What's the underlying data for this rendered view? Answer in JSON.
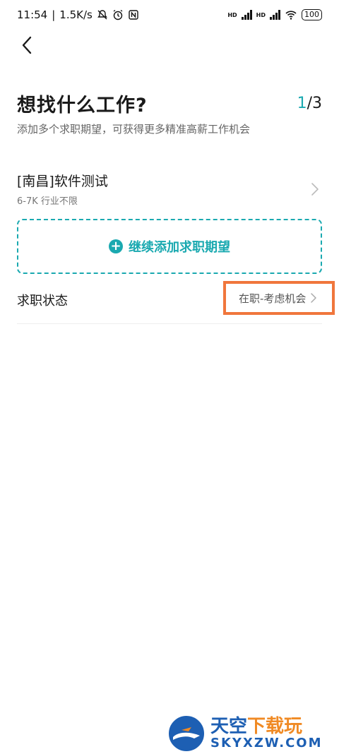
{
  "status_bar": {
    "time": "11:54",
    "net_speed": "1.5K/s",
    "hd1": "HD",
    "hd2": "HD",
    "battery": "100"
  },
  "header": {
    "title": "想找什么工作?",
    "step_current": "1",
    "step_total": "/3",
    "subtitle": "添加多个求职期望，可获得更多精准高薪工作机会"
  },
  "expectations": [
    {
      "title": "[南昌]软件测试",
      "desc": "6-7K 行业不限"
    }
  ],
  "add_button": {
    "label": "继续添加求职期望"
  },
  "job_status": {
    "label": "求职状态",
    "value": "在职-考虑机会"
  },
  "watermark": {
    "name_a": "天空",
    "name_b": "下载玩",
    "domain": "SKYXZW.COM"
  },
  "colors": {
    "accent": "#1aa9b0",
    "highlight": "#f0763c"
  }
}
